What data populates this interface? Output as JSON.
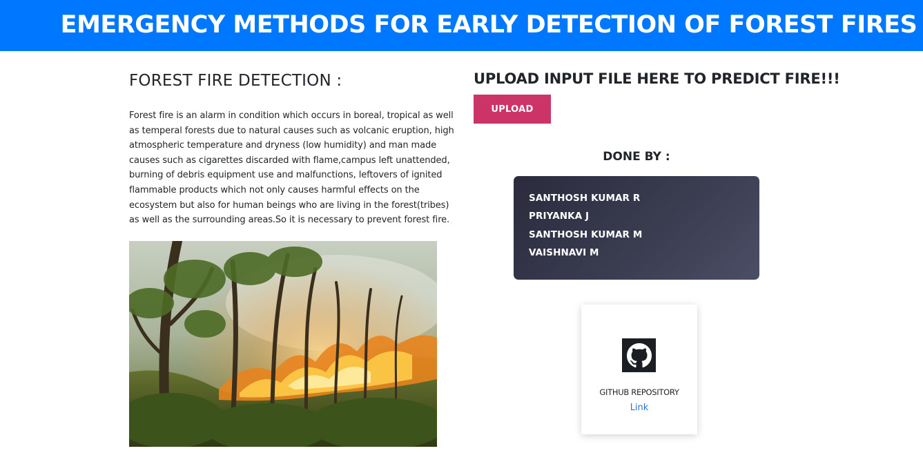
{
  "header": {
    "title": "EMERGENCY METHODS FOR EARLY DETECTION OF FOREST FIRES",
    "background_color": "#0077ff"
  },
  "about": {
    "heading": "FOREST FIRE DETECTION :",
    "description": "Forest fire is an alarm in condition which occurs in boreal, tropical as well as temperal forests due to natural causes such as volcanic eruption, high atmospheric temperature and dryness (low humidity) and man made causes such as cigarettes discarded with flame,campus left unattended, burning of debris equipment use and malfunctions, leftovers of ignited flammable products which not only causes harmful effects on the ecosystem but also for human beings who are living in the forest(tribes) as well as the surrounding areas.So it is necessary to prevent forest fire.",
    "image": "forest-fire-photo"
  },
  "upload": {
    "heading": "UPLOAD INPUT FILE HERE TO PREDICT FIRE!!!",
    "button_label": "UPLOAD",
    "button_color": "#cc3366"
  },
  "team": {
    "heading": "DONE BY :",
    "members": [
      "SANTHOSH KUMAR R",
      "PRIYANKA J",
      "SANTHOSH KUMAR M",
      "VAISHNAVI M"
    ]
  },
  "repository": {
    "icon": "github-icon",
    "label": "GITHUB REPOSITORY",
    "link_text": "Link",
    "link_color": "#2f72d9"
  }
}
